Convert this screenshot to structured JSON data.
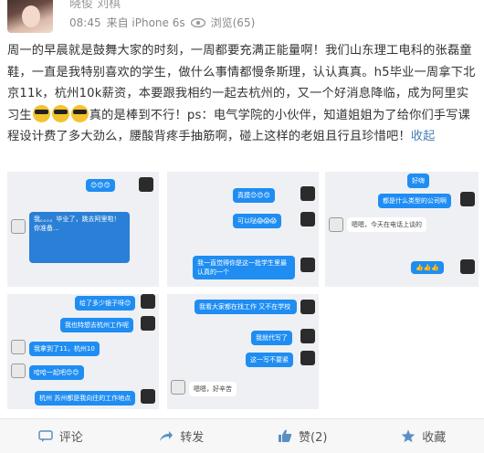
{
  "header": {
    "username": "晓俊 刘棋",
    "time": "08:45",
    "source": "来自 iPhone 6s",
    "views_label": "浏览(65)"
  },
  "post": {
    "text_part1": "周一的早晨就是鼓舞大家的时刻，一周都要充满正能量啊！我们山东理工电科的张磊童鞋，一直是我特别喜欢的学生，做什么事情都慢条斯理，认认真真。h5毕业一周拿下北京11k，杭州10k薪资，本要跟我相约一起去杭州的，又一个好消息降临，成为阿里实习生",
    "text_part2": "真的是棒到不行！ps：电气学院的小伙伴，知道姐姐为了给你们手写课程设计费了多大劲么，腰酸背疼手抽筋啊，碰上这样的老姐且行且珍惜吧！",
    "collapse_label": "收起"
  },
  "images": [
    {
      "bubbles_r": [
        "😊😊😊"
      ],
      "bubbles_l": [
        "我。。。。毕业了，跳去阿里啦！你准备..."
      ]
    },
    {
      "bubbles_r": [
        "真摸😊😊😊",
        "可以哒😱😱😱",
        "我一直觉得你是这一批学生里最认真的一个"
      ]
    },
    {
      "bubbles_r": [
        "好嗨",
        "都是什么类型的公司啊",
        "嗯嗯，今天在电话上谈的",
        "👍👍👍"
      ]
    },
    {
      "bubbles_r": [
        "给了多少银子呀😊",
        "我也特想去杭州工作呢",
        "哈哈一起吧😊😊"
      ],
      "bubbles_l": [
        "我拿到了11，杭州10",
        "杭州 苏州都是我向往的工作地点"
      ]
    },
    {
      "bubbles_r": [
        "我看大家都在找工作 又不在学校",
        "我就代写了",
        "这一写不要紧",
        "嗯嗯，好辛苦"
      ]
    }
  ],
  "footer": {
    "comment_label": "评论",
    "repost_label": "转发",
    "like_label": "赞(2)",
    "favorite_label": "收藏"
  },
  "colors": {
    "link": "#4a7fb5",
    "bubble_blue": "#1f8df2",
    "emoji_yellow": "#f4c32c"
  }
}
